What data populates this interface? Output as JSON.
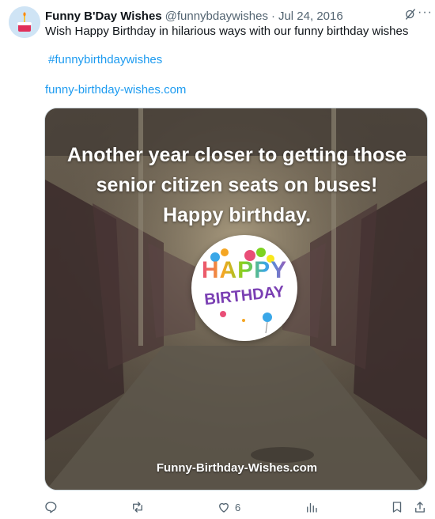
{
  "tweet": {
    "display_name": "Funny B'Day Wishes",
    "handle": "@funnybdaywishes",
    "separator": "·",
    "date": "Jul 24, 2016",
    "text": "Wish Happy Birthday in hilarious ways with our funny birthday wishes",
    "hashtag": "#funnybirthdaywishes",
    "link": "funny-birthday-wishes.com",
    "more_label": "···"
  },
  "media": {
    "quote_line1": "Another year closer to getting those",
    "quote_line2": "senior citizen seats on buses!",
    "quote_line3": "Happy birthday.",
    "badge_line1": "HAPPY",
    "badge_line2": "BIRTHDAY",
    "site_watermark": "Funny-Birthday-Wishes.com"
  },
  "actions": {
    "reply_count": "",
    "retweet_count": "",
    "like_count": "6",
    "views_count": ""
  },
  "icons": {
    "reply": "reply-icon",
    "retweet": "retweet-icon",
    "like": "heart-icon",
    "views": "views-icon",
    "bookmark": "bookmark-icon",
    "share": "share-icon",
    "grok": "grok-icon",
    "more": "more-icon"
  },
  "colors": {
    "link": "#1d9bf0",
    "muted": "#536471",
    "text": "#0f1419"
  }
}
